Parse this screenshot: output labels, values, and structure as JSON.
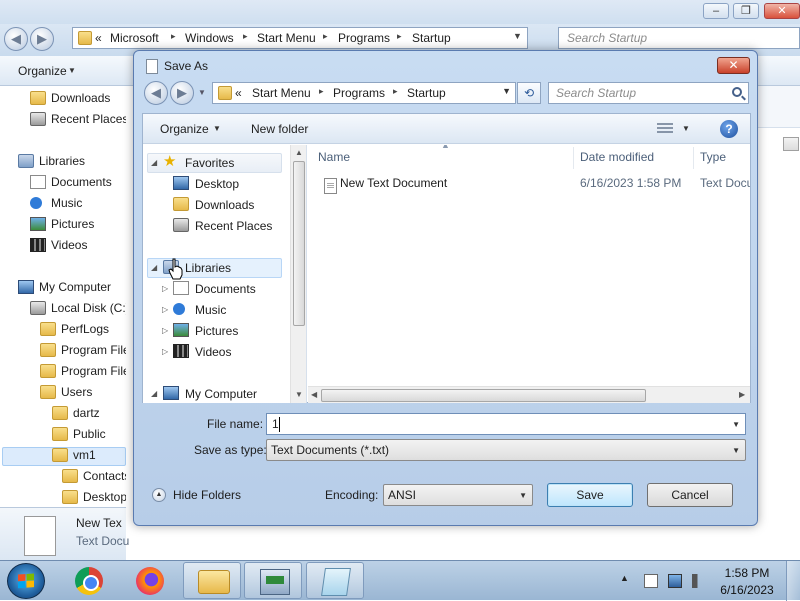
{
  "background_window": {
    "address_crumbs": [
      "«",
      "Microsoft",
      "Windows",
      "Start Menu",
      "Programs",
      "Startup"
    ],
    "search_placeholder": "Search Startup",
    "organize_label": "Organize",
    "tree": [
      {
        "label": "Downloads",
        "icon": "folder-icon"
      },
      {
        "label": "Recent Places",
        "icon": "recent-places-icon"
      },
      {
        "label": "Libraries",
        "icon": "libraries-icon"
      },
      {
        "label": "Documents",
        "icon": "documents-icon"
      },
      {
        "label": "Music",
        "icon": "music-icon"
      },
      {
        "label": "Pictures",
        "icon": "pictures-icon"
      },
      {
        "label": "Videos",
        "icon": "videos-icon"
      },
      {
        "label": "My Computer",
        "icon": "computer-icon"
      },
      {
        "label": "Local Disk (C:)",
        "icon": "disk-icon"
      },
      {
        "label": "PerfLogs",
        "icon": "folder-icon"
      },
      {
        "label": "Program Files",
        "icon": "folder-icon"
      },
      {
        "label": "Program Files",
        "icon": "folder-icon"
      },
      {
        "label": "Users",
        "icon": "folder-icon"
      },
      {
        "label": "dartz",
        "icon": "folder-icon"
      },
      {
        "label": "Public",
        "icon": "folder-icon"
      },
      {
        "label": "vm1",
        "icon": "locked-folder-icon"
      },
      {
        "label": "Contacts",
        "icon": "folder-icon"
      },
      {
        "label": "Desktop",
        "icon": "folder-icon"
      }
    ],
    "details": {
      "name": "New Tex",
      "type": "Text Docu"
    }
  },
  "dialog": {
    "title": "Save As",
    "address_crumbs": [
      "«",
      "Start Menu",
      "Programs",
      "Startup"
    ],
    "search_placeholder": "Search Startup",
    "organize_label": "Organize",
    "new_folder_label": "New folder",
    "help_label": "?",
    "nav": {
      "favorites": "Favorites",
      "favorites_items": [
        "Desktop",
        "Downloads",
        "Recent Places"
      ],
      "libraries": "Libraries",
      "libraries_items": [
        "Documents",
        "Music",
        "Pictures",
        "Videos"
      ],
      "computer": "My Computer"
    },
    "columns": [
      "Name",
      "Date modified",
      "Type"
    ],
    "files": [
      {
        "name": "New Text Document",
        "date": "6/16/2023 1:58 PM",
        "type": "Text Docu"
      }
    ],
    "filename_label": "File name:",
    "filename_value": "1",
    "savetype_label": "Save as type:",
    "savetype_value": "Text Documents (*.txt)",
    "hide_folders_label": "Hide Folders",
    "encoding_label": "Encoding:",
    "encoding_value": "ANSI",
    "save_label": "Save",
    "cancel_label": "Cancel"
  },
  "taskbar": {
    "apps": [
      "start-orb-icon",
      "chrome-icon",
      "firefox-icon",
      "explorer-icon",
      "network-app-icon",
      "notepad-icon"
    ],
    "time": "1:58 PM",
    "date": "6/16/2023"
  }
}
